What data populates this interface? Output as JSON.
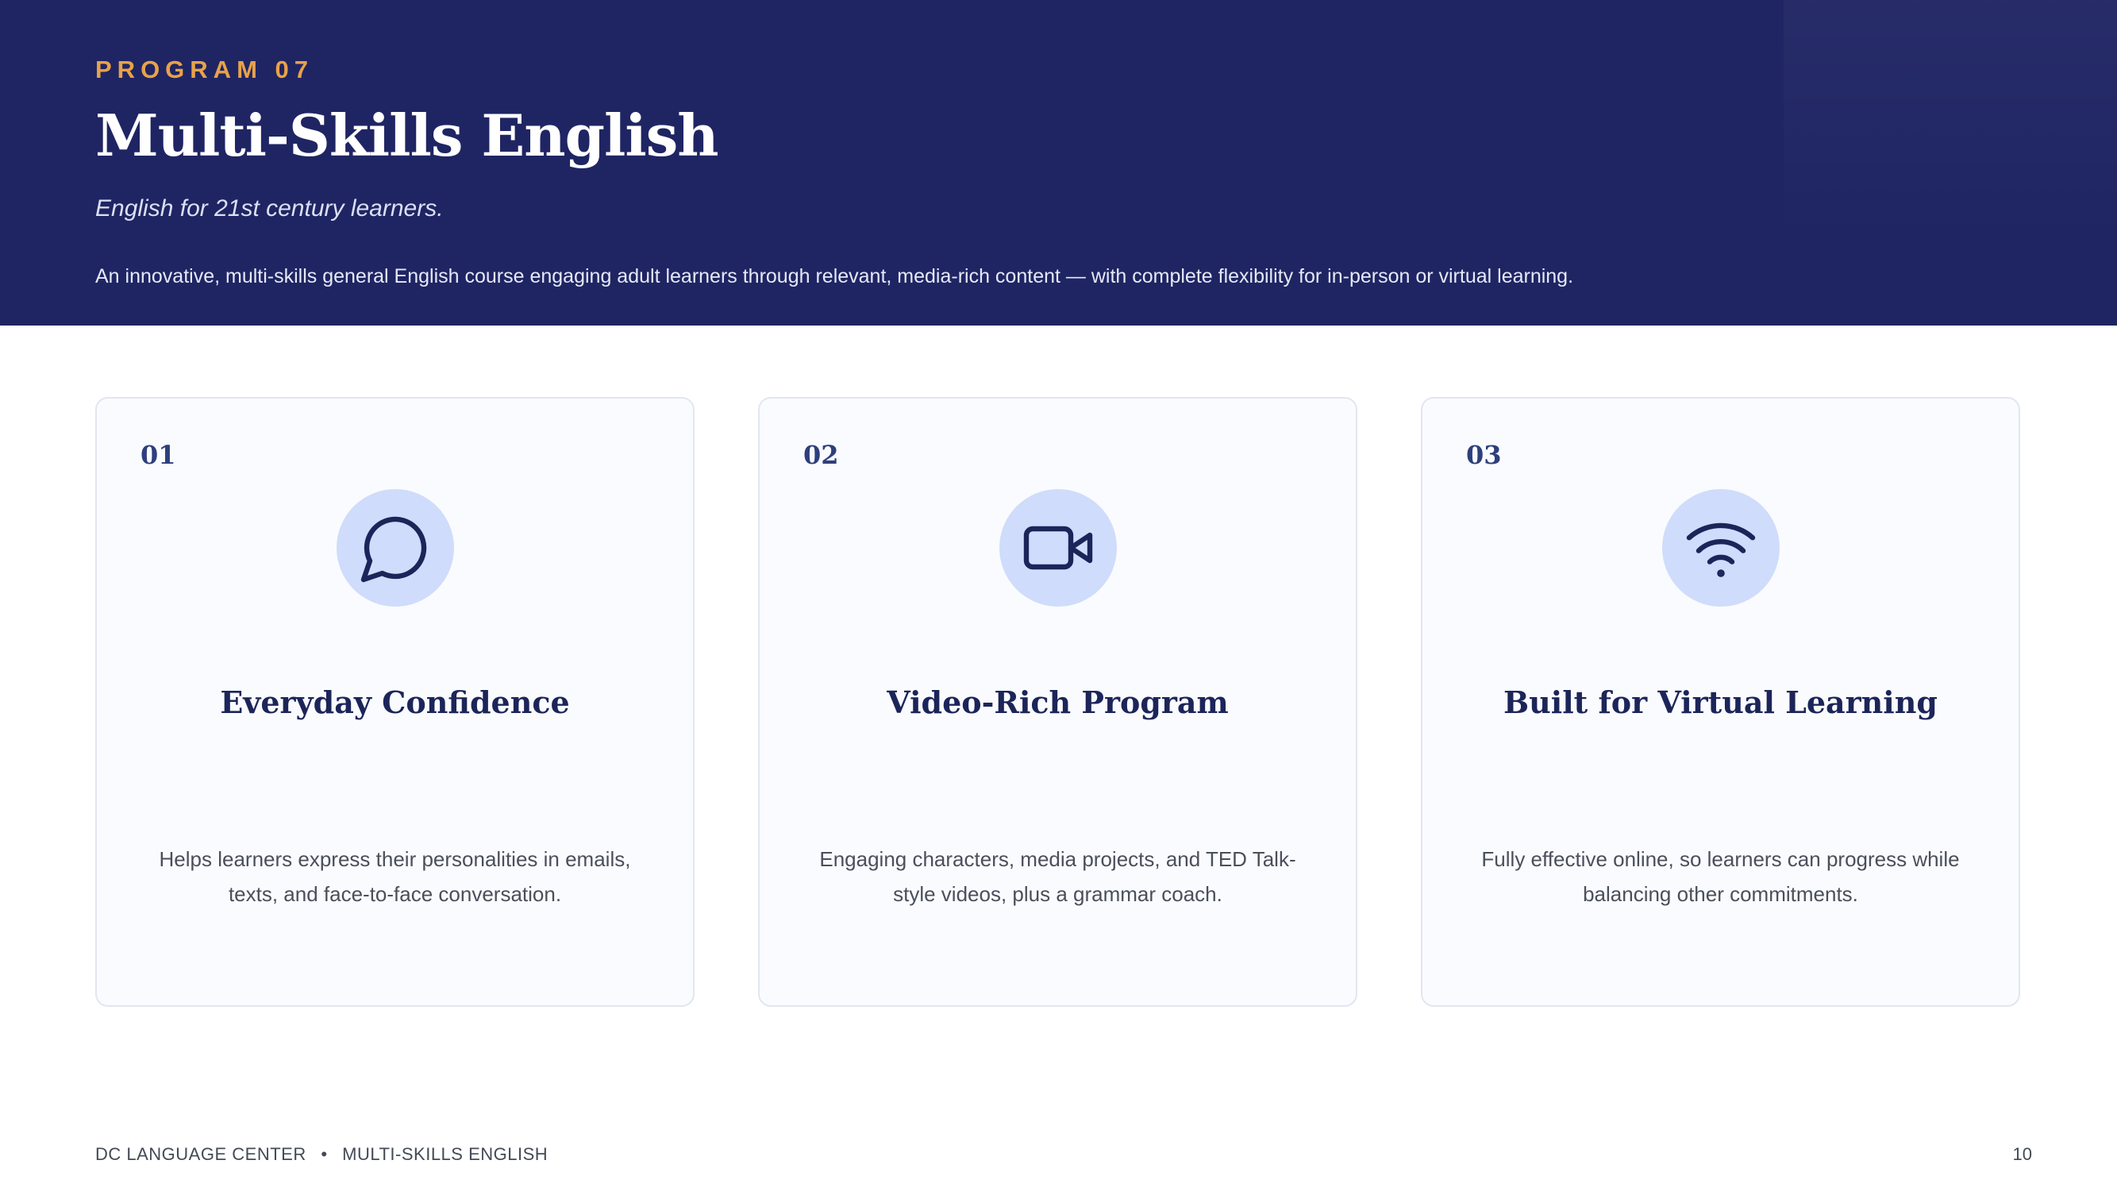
{
  "header": {
    "kicker": "PROGRAM 07",
    "title": "Multi-Skills English",
    "subtitle": "English for 21st century learners.",
    "description": "An innovative, multi-skills general English course engaging adult learners through relevant, media-rich content — with complete flexibility for in-person or virtual learning."
  },
  "cards": [
    {
      "number": "01",
      "icon": "chat-bubble-icon",
      "title": "Everyday Confidence",
      "text": "Helps learners express their personalities in emails, texts, and face-to-face conversation."
    },
    {
      "number": "02",
      "icon": "video-camera-icon",
      "title": "Video-Rich Program",
      "text": "Engaging characters, media projects, and TED Talk-style videos, plus a grammar coach."
    },
    {
      "number": "03",
      "icon": "wifi-icon",
      "title": "Built for Virtual Learning",
      "text": "Fully effective online, so learners can progress while balancing other commitments."
    }
  ],
  "footer": {
    "organization": "DC LANGUAGE CENTER",
    "separator": "•",
    "program": "MULTI-SKILLS ENGLISH",
    "page_number": "10"
  },
  "colors": {
    "header_bg": "#1f2563",
    "accent": "#e8a24a",
    "icon_circle": "#cfdcfb",
    "icon_stroke": "#1c2559"
  }
}
